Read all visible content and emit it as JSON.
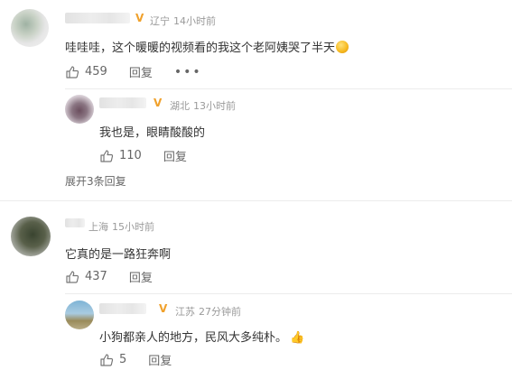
{
  "comments": [
    {
      "location": "辽宁",
      "time": "14小时前",
      "text": "哇哇哇，这个暖暖的视频看的我这个老阿姨哭了半天",
      "likes": "459",
      "reply_label": "回复",
      "more_label": "•••"
    },
    {
      "location": "湖北",
      "time": "13小时前",
      "text": "我也是，眼睛酸酸的",
      "likes": "110",
      "reply_label": "回复"
    },
    {
      "location": "上海",
      "time": "15小时前",
      "text": "它真的是一路狂奔啊",
      "likes": "437",
      "reply_label": "回复"
    },
    {
      "location": "江苏",
      "time": "27分钟前",
      "text": "小狗都亲人的地方，民风大多纯朴。",
      "likes": "5",
      "reply_label": "回复"
    }
  ],
  "expand_label": "展开3条回复",
  "vip_mark": "V",
  "colors": {
    "vip": "#f0a12c",
    "meta": "#9a9a9a",
    "text": "#333333"
  }
}
